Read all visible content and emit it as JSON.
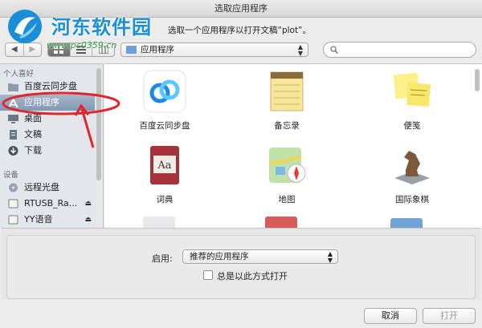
{
  "window": {
    "title": "选取应用程序"
  },
  "watermark": {
    "title": "河东软件园",
    "url": "www.pc0359.cn"
  },
  "prompt": "选取一个应用程序以打开文稿“plot”。",
  "toolbar": {
    "back_glyph": "◀",
    "forward_glyph": "▶",
    "view_icons": [
      "icon-view-icon",
      "list-view-icon",
      "column-view-icon"
    ],
    "path_label": "应用程序",
    "search_placeholder": ""
  },
  "sidebar": {
    "favorites_header": "个人喜好",
    "favorites": [
      {
        "label": "百度云同步盘",
        "icon": "folder-icon"
      },
      {
        "label": "应用程序",
        "icon": "applications-icon",
        "selected": true
      },
      {
        "label": "桌面",
        "icon": "desktop-icon"
      },
      {
        "label": "文稿",
        "icon": "documents-icon"
      },
      {
        "label": "下载",
        "icon": "downloads-icon"
      }
    ],
    "devices_header": "设备",
    "devices": [
      {
        "label": "远程光盘",
        "icon": "remote-disc-icon"
      },
      {
        "label": "RTUSB_Ra...",
        "icon": "drive-icon",
        "eject": "⏏"
      },
      {
        "label": "YY语音",
        "icon": "drive-icon",
        "eject": "⏏"
      }
    ]
  },
  "apps": [
    {
      "name": "百度云同步盘",
      "icon": "baidu-cloud-icon"
    },
    {
      "name": "备忘录",
      "icon": "notes-icon"
    },
    {
      "name": "便笺",
      "icon": "stickies-icon"
    },
    {
      "name": "词典",
      "icon": "dictionary-icon"
    },
    {
      "name": "地图",
      "icon": "maps-icon"
    },
    {
      "name": "国际象棋",
      "icon": "chess-icon"
    }
  ],
  "options": {
    "enable_label": "启用:",
    "enable_value": "推荐的应用程序",
    "always_open_label": "总是以此方式打开",
    "always_open_checked": false
  },
  "buttons": {
    "cancel": "取消",
    "open": "打开"
  },
  "colors": {
    "selection": "#8aa0bb",
    "annotation": "#e0262b",
    "watermark_blue": "#1a8fd6",
    "watermark_green": "#2f9c3b"
  }
}
